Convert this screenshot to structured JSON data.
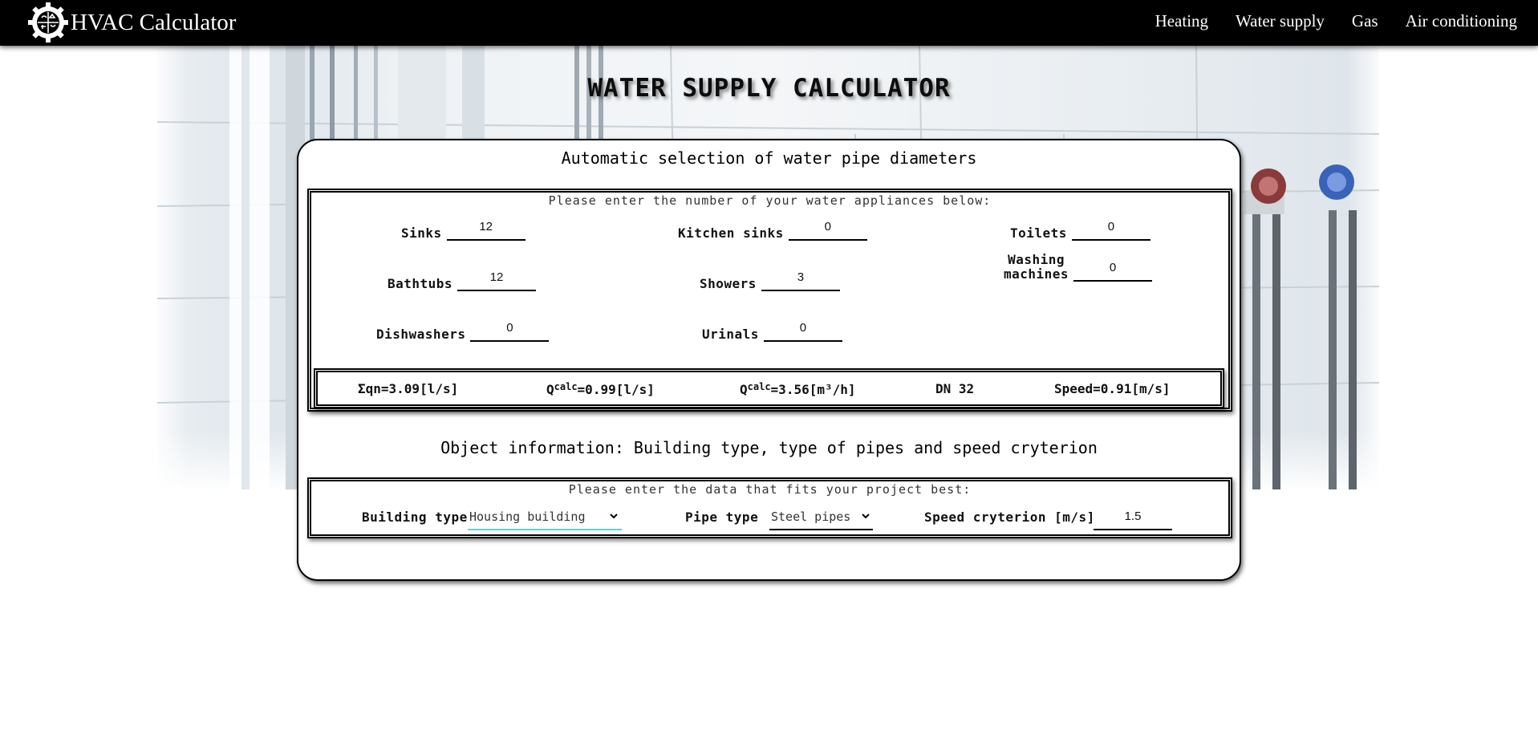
{
  "app": {
    "brand_title": "HVAC Calculator",
    "logo_icon": "gear-logo-icon"
  },
  "nav": {
    "items": [
      {
        "label": "Heating"
      },
      {
        "label": "Water supply"
      },
      {
        "label": "Gas"
      },
      {
        "label": "Air conditioning"
      }
    ]
  },
  "hero": {
    "title": "WATER SUPPLY CALCULATOR"
  },
  "appliances": {
    "section_title": "Automatic selection of water pipe diameters",
    "note": "Please enter the number of your water appliances below:",
    "fields": {
      "sinks": {
        "label": "Sinks",
        "value": "12"
      },
      "kitchen_sinks": {
        "label": "Kitchen sinks",
        "value": "0"
      },
      "toilets": {
        "label": "Toilets",
        "value": "0"
      },
      "bathtubs": {
        "label": "Bathtubs",
        "value": "12"
      },
      "showers": {
        "label": "Showers",
        "value": "3"
      },
      "washing_machines": {
        "label_line1": "Washing",
        "label_line2": "machines",
        "value": "0"
      },
      "dishwashers": {
        "label": "Dishwashers",
        "value": "0"
      },
      "urinals": {
        "label": "Urinals",
        "value": "0"
      }
    }
  },
  "results": {
    "sum_qn": "Σqn=3.09[l/s]",
    "q_calc_ls_prefix": "Q",
    "q_calc_ls_sup": "calc",
    "q_calc_ls_value": "=0.99[l/s]",
    "q_calc_m3h_prefix": "Q",
    "q_calc_m3h_sup": "calc",
    "q_calc_m3h_value": "=3.56[m³/h]",
    "dn": "DN 32",
    "speed": "Speed=0.91[m/s]"
  },
  "object": {
    "section_title": "Object information: Building type, type of pipes and speed cryterion",
    "note": "Please enter the data that fits your project best:",
    "building_type": {
      "label": "Building type",
      "selected": "Housing building"
    },
    "pipe_type": {
      "label": "Pipe type",
      "selected": "Steel pipes"
    },
    "speed_criterion": {
      "label": "Speed cryterion [m/s]",
      "value": "1.5"
    }
  },
  "colors": {
    "navbar": "#000000",
    "focus_underline": "#2ee8e0"
  }
}
